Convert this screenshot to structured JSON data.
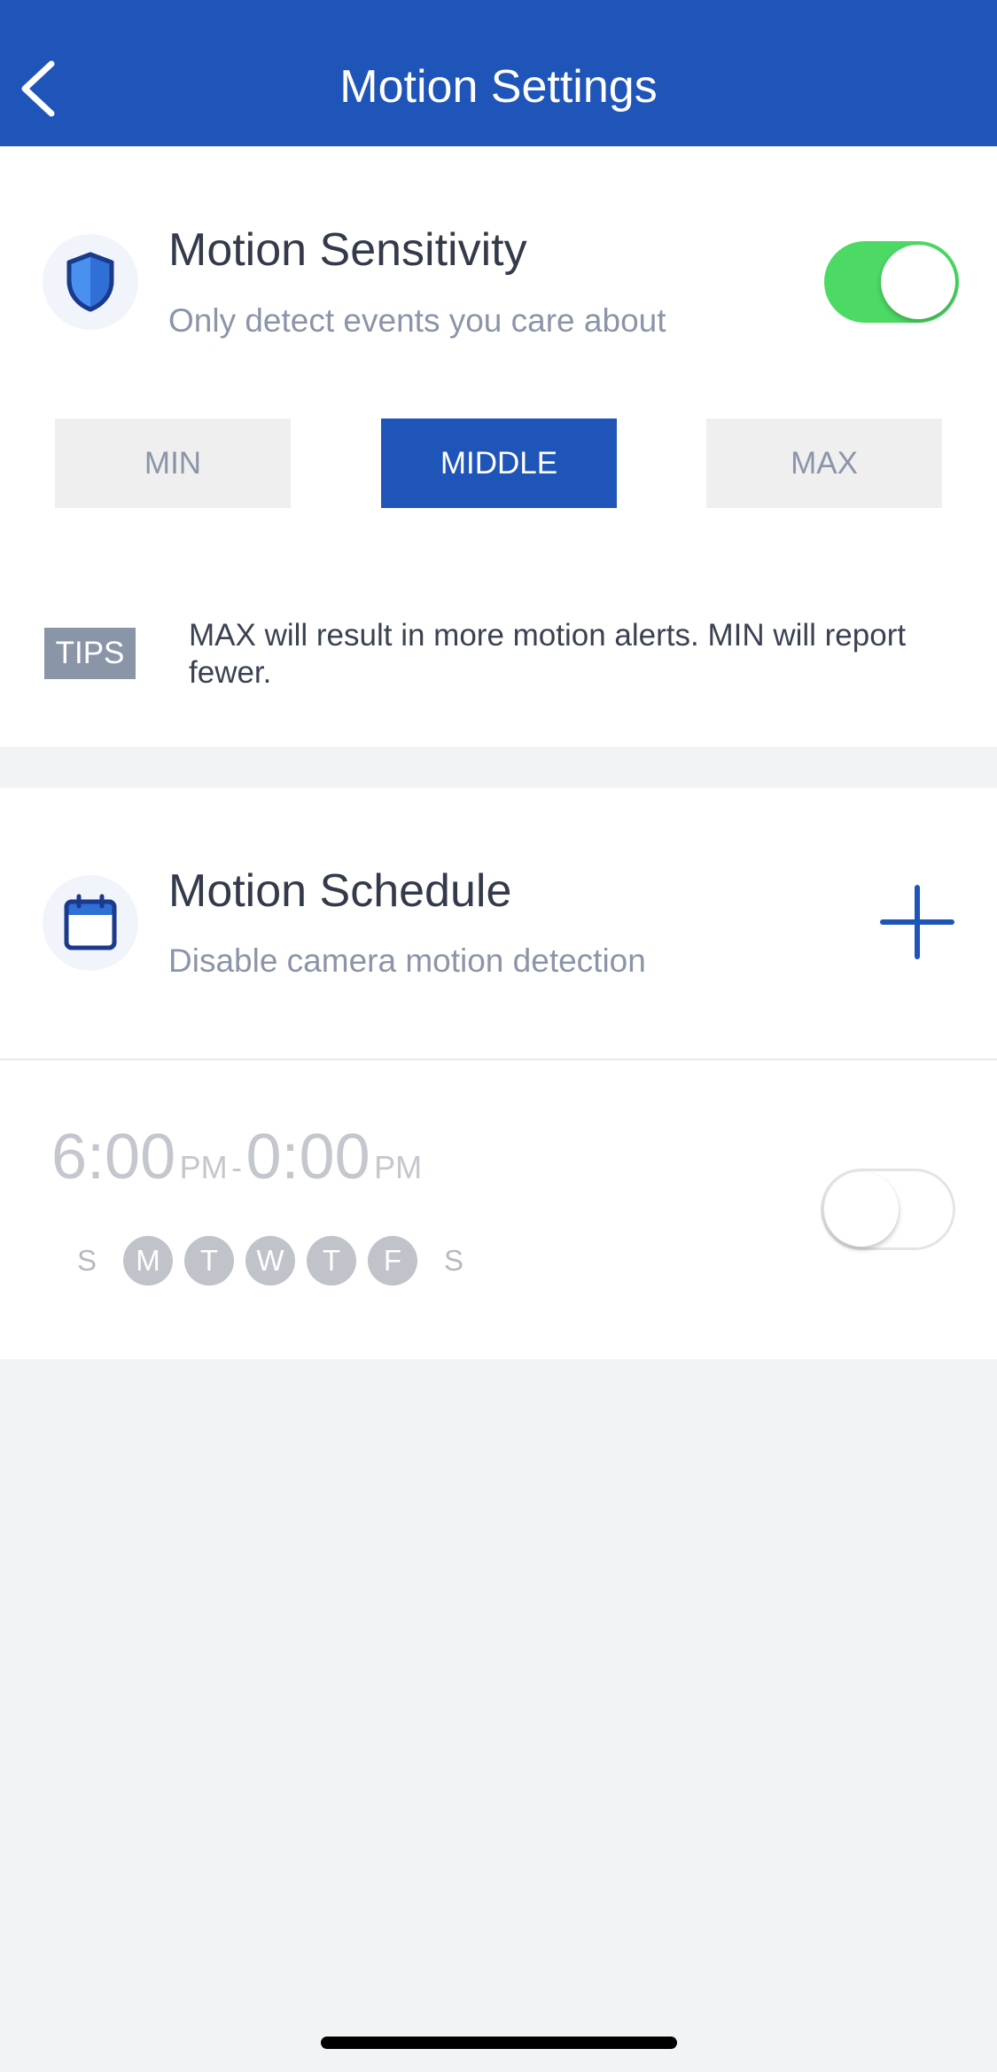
{
  "header": {
    "title": "Motion Settings"
  },
  "sensitivity": {
    "title": "Motion Sensitivity",
    "subtitle": "Only detect events you care about",
    "enabled": true,
    "levels": [
      "MIN",
      "MIDDLE",
      "MAX"
    ],
    "selected": "MIDDLE",
    "tips_label": "TIPS",
    "tips_text": "MAX will result in more motion alerts. MIN will report fewer."
  },
  "schedule": {
    "title": "Motion Schedule",
    "subtitle": "Disable camera motion detection",
    "item": {
      "start_time": "6:00",
      "start_period": "PM",
      "separator": "-",
      "end_time": "0:00",
      "end_period": "PM",
      "enabled": false,
      "days": [
        {
          "label": "S",
          "active": false
        },
        {
          "label": "M",
          "active": true
        },
        {
          "label": "T",
          "active": true
        },
        {
          "label": "W",
          "active": true
        },
        {
          "label": "T",
          "active": true
        },
        {
          "label": "F",
          "active": true
        },
        {
          "label": "S",
          "active": false
        }
      ]
    }
  },
  "colors": {
    "accent": "#1f55b9",
    "toggle_on": "#4cd964",
    "muted": "#8b95a8"
  }
}
